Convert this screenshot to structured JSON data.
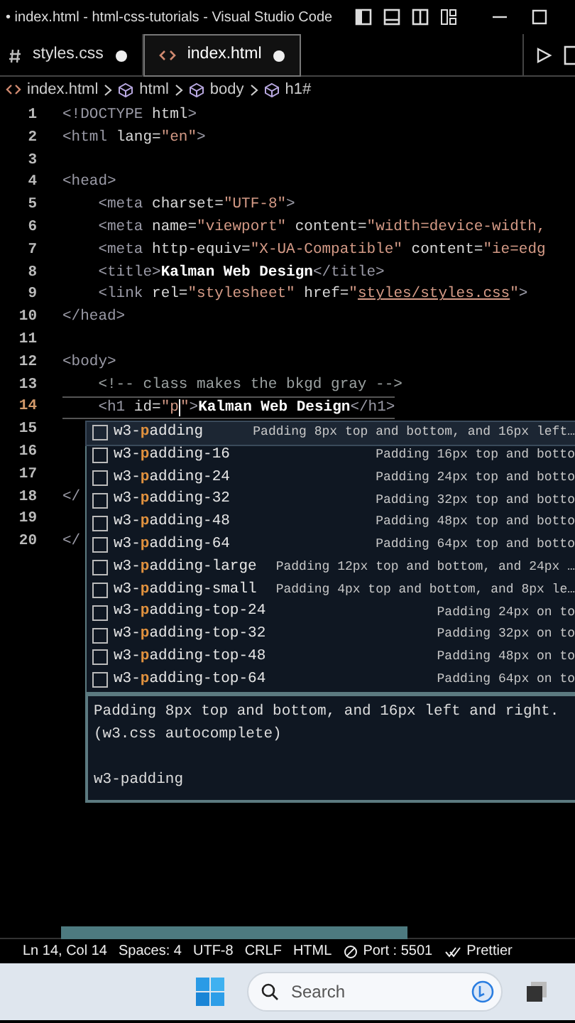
{
  "window": {
    "title": "• index.html - html-css-tutorials - Visual Studio Code"
  },
  "tabs": [
    {
      "label": "styles.css",
      "kind": "css",
      "modified": true,
      "selected": false
    },
    {
      "label": "index.html",
      "kind": "html",
      "modified": true,
      "selected": true
    }
  ],
  "breadcrumbs": [
    {
      "label": "index.html",
      "kind": "file"
    },
    {
      "label": "html",
      "kind": "element"
    },
    {
      "label": "body",
      "kind": "element"
    },
    {
      "label": "h1#",
      "kind": "element"
    }
  ],
  "editor": {
    "lines": [
      {
        "number": "1",
        "current": false,
        "tokens": [
          {
            "kind": "tag",
            "text": "<!DOCTYPE"
          },
          {
            "kind": "attr",
            "text": " html"
          },
          {
            "kind": "tag",
            "text": ">"
          }
        ]
      },
      {
        "number": "2",
        "current": false,
        "tokens": [
          {
            "kind": "tag",
            "text": "<html"
          },
          {
            "kind": "attr",
            "text": " lang="
          },
          {
            "kind": "value",
            "text": "\"en\""
          },
          {
            "kind": "tag",
            "text": ">"
          }
        ]
      },
      {
        "number": "3",
        "current": false
      },
      {
        "number": "4",
        "current": false,
        "tokens": [
          {
            "kind": "tag",
            "text": "<head>"
          }
        ]
      },
      {
        "number": "5",
        "current": false,
        "tokens": [
          {
            "kind": "tag",
            "text": "    <meta"
          },
          {
            "kind": "attr",
            "text": " charset="
          },
          {
            "kind": "value",
            "text": "\"UTF-8\""
          },
          {
            "kind": "tag",
            "text": ">"
          }
        ]
      },
      {
        "number": "6",
        "current": false,
        "tokens": [
          {
            "kind": "tag",
            "text": "    <meta"
          },
          {
            "kind": "attr",
            "text": " name="
          },
          {
            "kind": "value",
            "text": "\"viewport\""
          },
          {
            "kind": "attr",
            "text": " content="
          },
          {
            "kind": "value",
            "text": "\"width=device-width,"
          }
        ]
      },
      {
        "number": "7",
        "current": false,
        "tokens": [
          {
            "kind": "tag",
            "text": "    <meta"
          },
          {
            "kind": "attr",
            "text": " http-equiv="
          },
          {
            "kind": "value",
            "text": "\"X-UA-Compatible\""
          },
          {
            "kind": "attr",
            "text": " content="
          },
          {
            "kind": "value",
            "text": "\"ie=edg"
          }
        ]
      },
      {
        "number": "8",
        "current": false,
        "tokens": [
          {
            "kind": "tag",
            "text": "    <title>"
          },
          {
            "kind": "text",
            "text": "Kalman Web Design"
          },
          {
            "kind": "tag",
            "text": "</title>"
          }
        ]
      },
      {
        "number": "9",
        "current": false,
        "tokens": [
          {
            "kind": "tag",
            "text": "    <link"
          },
          {
            "kind": "attr",
            "text": " rel="
          },
          {
            "kind": "value",
            "text": "\"stylesheet\""
          },
          {
            "kind": "attr",
            "text": " href="
          },
          {
            "kind": "value",
            "text": "\""
          },
          {
            "kind": "link",
            "text": "styles/styles.css"
          },
          {
            "kind": "value",
            "text": "\""
          },
          {
            "kind": "tag",
            "text": ">"
          }
        ]
      },
      {
        "number": "10",
        "current": false,
        "tokens": [
          {
            "kind": "tag",
            "text": "</head>"
          }
        ]
      },
      {
        "number": "11",
        "current": false
      },
      {
        "number": "12",
        "current": false,
        "tokens": [
          {
            "kind": "tag",
            "text": "<body>"
          }
        ]
      },
      {
        "number": "13",
        "current": false,
        "tokens": [
          {
            "kind": "comment",
            "text": "    <!-- class makes the bkgd gray -->"
          }
        ]
      },
      {
        "number": "14",
        "current": true,
        "tokens": [
          {
            "kind": "tag",
            "text": "    <h1"
          },
          {
            "kind": "attr",
            "text": " id="
          },
          {
            "kind": "value",
            "text": "\"p",
            "caret": true
          },
          {
            "kind": "value",
            "text": "\""
          },
          {
            "kind": "tag",
            "text": ">"
          },
          {
            "kind": "text",
            "text": "Kalman Web Design"
          },
          {
            "kind": "tag",
            "text": "</h1>"
          }
        ]
      },
      {
        "number": "15",
        "current": false
      },
      {
        "number": "16",
        "current": false
      },
      {
        "number": "17",
        "current": false
      },
      {
        "number": "18",
        "current": false,
        "tokens": [
          {
            "kind": "tag",
            "text": "</"
          }
        ]
      },
      {
        "number": "19",
        "current": false
      },
      {
        "number": "20",
        "current": false,
        "tokens": [
          {
            "kind": "tag",
            "text": "</"
          }
        ]
      }
    ]
  },
  "suggestions": {
    "items": [
      {
        "prefix": "w3-",
        "match": "p",
        "rest": "adding",
        "detail": "Padding 8px top and bottom, and 16px left…",
        "selected": true
      },
      {
        "prefix": "w3-",
        "match": "p",
        "rest": "adding-16",
        "detail": "Padding 16px top and botto",
        "selected": false
      },
      {
        "prefix": "w3-",
        "match": "p",
        "rest": "adding-24",
        "detail": "Padding 24px top and botto",
        "selected": false
      },
      {
        "prefix": "w3-",
        "match": "p",
        "rest": "adding-32",
        "detail": "Padding 32px top and botto",
        "selected": false
      },
      {
        "prefix": "w3-",
        "match": "p",
        "rest": "adding-48",
        "detail": "Padding 48px top and botto",
        "selected": false
      },
      {
        "prefix": "w3-",
        "match": "p",
        "rest": "adding-64",
        "detail": "Padding 64px top and botto",
        "selected": false
      },
      {
        "prefix": "w3-",
        "match": "p",
        "rest": "adding-large",
        "detail": "Padding 12px top and bottom, and 24px …",
        "selected": false
      },
      {
        "prefix": "w3-",
        "match": "p",
        "rest": "adding-small",
        "detail": "Padding 4px top and bottom, and 8px le…",
        "selected": false
      },
      {
        "prefix": "w3-",
        "match": "p",
        "rest": "adding-top-24",
        "detail": "Padding 24px on to",
        "selected": false
      },
      {
        "prefix": "w3-",
        "match": "p",
        "rest": "adding-top-32",
        "detail": "Padding 32px on to",
        "selected": false
      },
      {
        "prefix": "w3-",
        "match": "p",
        "rest": "adding-top-48",
        "detail": "Padding 48px on to",
        "selected": false
      },
      {
        "prefix": "w3-",
        "match": "p",
        "rest": "adding-top-64",
        "detail": "Padding 64px on to",
        "selected": false
      }
    ],
    "details": {
      "description": "Padding 8px top and bottom, and 16px left and right.",
      "source": "(w3.css autocomplete)",
      "name": "w3-padding"
    }
  },
  "status_bar": [
    {
      "text": "Ln 14, Col 14",
      "kind": "plain"
    },
    {
      "text": "Spaces: 4",
      "kind": "plain"
    },
    {
      "text": "UTF-8",
      "kind": "plain"
    },
    {
      "text": "CRLF",
      "kind": "plain"
    },
    {
      "text": "HTML",
      "kind": "plain"
    },
    {
      "text": "Port : 5501",
      "kind": "port"
    },
    {
      "text": "Prettier",
      "kind": "check"
    }
  ],
  "taskbar": {
    "search": {
      "placeholder": "Search"
    }
  }
}
